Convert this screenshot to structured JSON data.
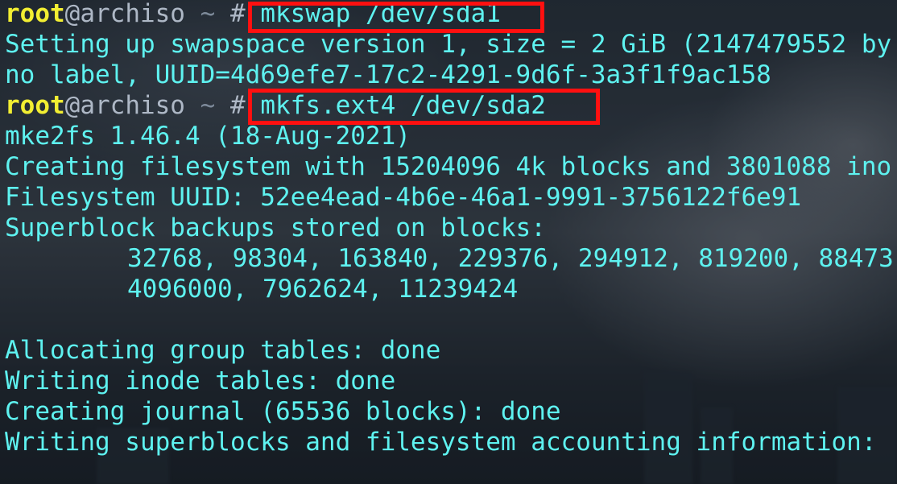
{
  "prompts": [
    {
      "user": "root",
      "at": "@",
      "host": "archiso",
      "tilde": "~",
      "hash": "#",
      "command": "mkswap /dev/sda1"
    },
    {
      "user": "root",
      "at": "@",
      "host": "archiso",
      "tilde": "~",
      "hash": "#",
      "command": "mkfs.ext4 /dev/sda2"
    }
  ],
  "output": {
    "swap_setup": "Setting up swapspace version 1, size = 2 GiB (2147479552 by",
    "swap_uuid": "no label, UUID=4d69efe7-17c2-4291-9d6f-3a3f1f9ac158",
    "mke2fs_version": "mke2fs 1.46.4 (18-Aug-2021)",
    "creating_fs": "Creating filesystem with 15204096 4k blocks and 3801088 ino",
    "fs_uuid": "Filesystem UUID: 52ee4ead-4b6e-46a1-9991-3756122f6e91",
    "superblock_header": "Superblock backups stored on blocks:",
    "superblock_list_1": "32768, 98304, 163840, 229376, 294912, 819200, 88473",
    "superblock_list_2": "4096000, 7962624, 11239424",
    "alloc_tables": "Allocating group tables: done",
    "inode_tables": "Writing inode tables: done",
    "journal": "Creating journal (65536 blocks): done",
    "superblocks": "Writing superblocks and filesystem accounting information:"
  },
  "colors": {
    "output_text": "#5ef2f0",
    "user": "#f2ee32",
    "highlight_border": "#ff1010"
  }
}
